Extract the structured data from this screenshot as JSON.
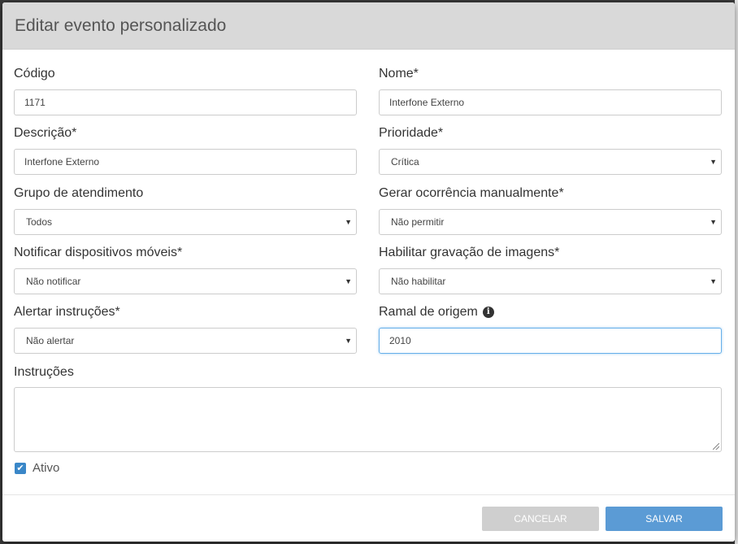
{
  "modal": {
    "title": "Editar evento personalizado"
  },
  "fields": {
    "codigo": {
      "label": "Código",
      "value": "1171"
    },
    "nome": {
      "label": "Nome*",
      "value": "Interfone Externo"
    },
    "descricao": {
      "label": "Descrição*",
      "value": "Interfone Externo"
    },
    "prioridade": {
      "label": "Prioridade*",
      "value": "Crítica"
    },
    "grupo": {
      "label": "Grupo de atendimento",
      "value": "Todos"
    },
    "gerar": {
      "label": "Gerar ocorrência manualmente*",
      "value": "Não permitir"
    },
    "notificar": {
      "label": "Notificar dispositivos móveis*",
      "value": "Não notificar"
    },
    "gravacao": {
      "label": "Habilitar gravação de imagens*",
      "value": "Não habilitar"
    },
    "alertar": {
      "label": "Alertar instruções*",
      "value": "Não alertar"
    },
    "ramal": {
      "label": "Ramal de origem",
      "value": "2010"
    },
    "instrucoes": {
      "label": "Instruções",
      "value": ""
    }
  },
  "ativo": {
    "label": "Ativo",
    "checked": true
  },
  "footer": {
    "cancel_label": "CANCELAR",
    "save_label": "SALVAR"
  },
  "colors": {
    "header_bg": "#d9d9d9",
    "primary": "#5b9bd5",
    "disabled": "#cfcfcf",
    "checkbox": "#3a87c8"
  }
}
